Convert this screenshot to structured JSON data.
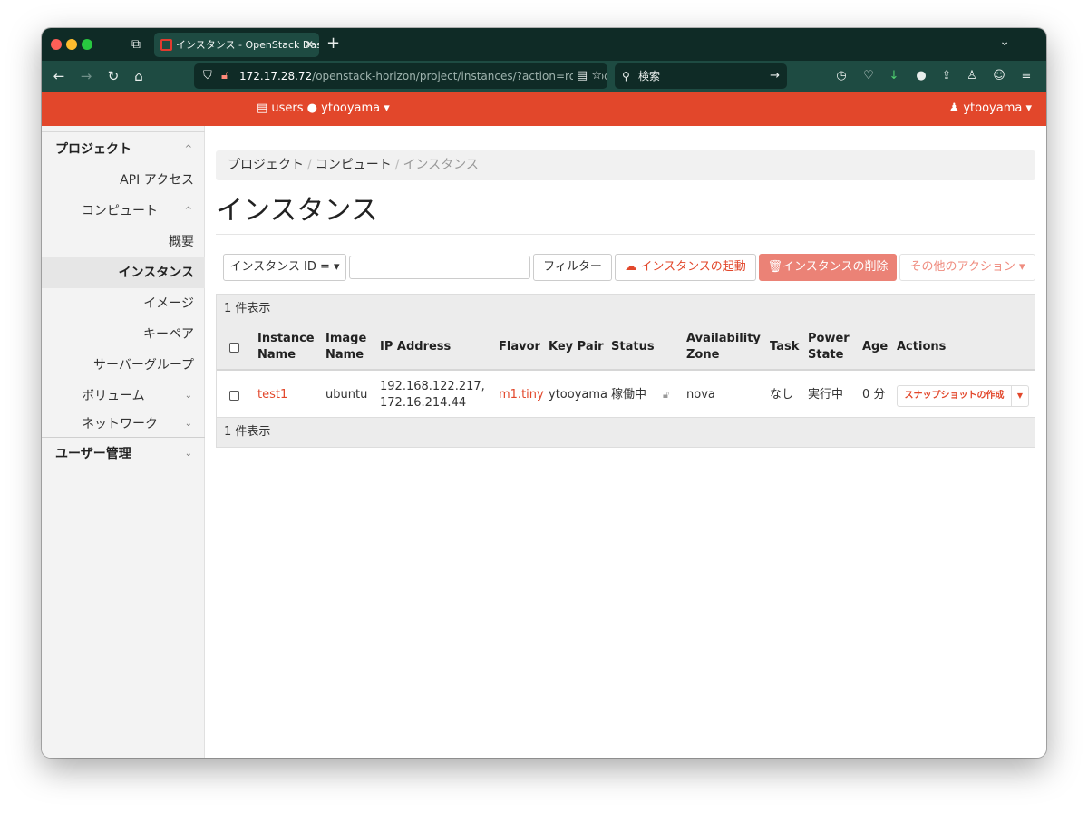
{
  "browser": {
    "tab_title": "インスタンス - OpenStack Dashboard",
    "tab_close": "✕",
    "new_tab": "+",
    "url_host": "172.17.28.72",
    "url_path": "/openstack-horizon/project/instances/?action=row_upda",
    "search_placeholder": "検索"
  },
  "header": {
    "project_label": "users ● ytooyama ▾",
    "user_label": "ytooyama ▾"
  },
  "sidebar": {
    "project_group": "プロジェクト",
    "api_access": "API アクセス",
    "compute": "コンピュート",
    "overview": "概要",
    "instances": "インスタンス",
    "images": "イメージ",
    "keypairs": "キーペア",
    "server_groups": "サーバーグループ",
    "volumes": "ボリューム",
    "network": "ネットワーク",
    "identity_group": "ユーザー管理"
  },
  "breadcrumb": {
    "project": "プロジェクト",
    "compute": "コンピュート",
    "current": "インスタンス"
  },
  "page_title": "インスタンス",
  "toolbar": {
    "filter_field": "インスタンス ID = ▾",
    "filter_value": "",
    "filter_button": "フィルター",
    "launch_button": "インスタンスの起動",
    "delete_button": "インスタンスの削除",
    "more_actions": "その他のアクション ▾"
  },
  "table": {
    "count_label": "1 件表示",
    "headers": {
      "instance_name": "Instance Name",
      "image_name": "Image Name",
      "ip_address": "IP Address",
      "flavor": "Flavor",
      "key_pair": "Key Pair",
      "status": "Status",
      "availability_zone": "Availability Zone",
      "task": "Task",
      "power_state": "Power State",
      "age": "Age",
      "actions": "Actions"
    },
    "rows": [
      {
        "instance_name": "test1",
        "image_name": "ubuntu",
        "ip_address_1": "192.168.122.217,",
        "ip_address_2": "172.16.214.44",
        "flavor": "m1.tiny",
        "key_pair": "ytooyama",
        "status": "稼働中",
        "availability_zone": "nova",
        "task": "なし",
        "power_state": "実行中",
        "age": "0 分",
        "action_button": "スナップショットの作成"
      }
    ]
  },
  "colors": {
    "brand": "#e2472b",
    "browser_dark": "#0f2b26",
    "browser_mid": "#1e4b42"
  }
}
